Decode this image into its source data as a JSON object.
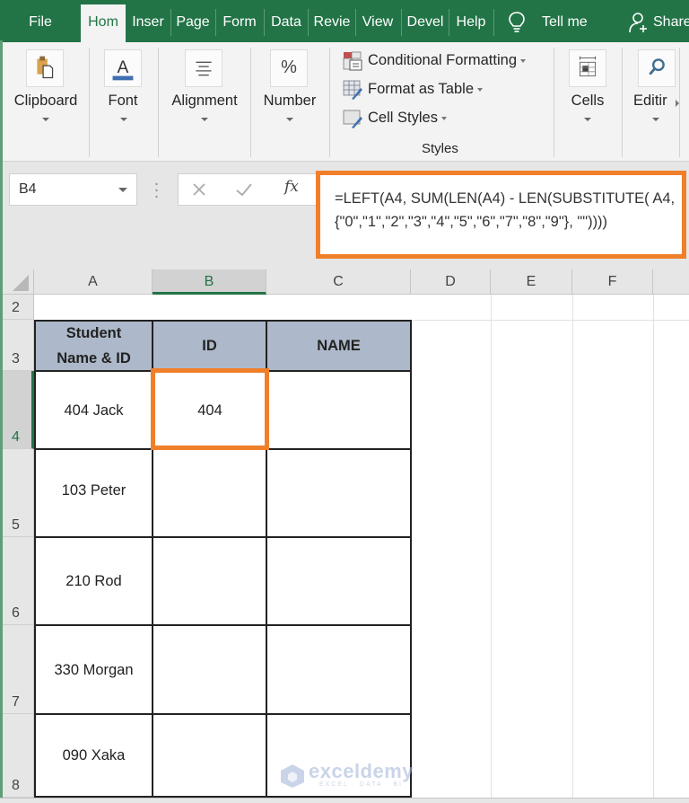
{
  "tabs": [
    {
      "label": "File",
      "active": false
    },
    {
      "label": "Hom",
      "active": true
    },
    {
      "label": "Inser",
      "active": false
    },
    {
      "label": "Page",
      "active": false
    },
    {
      "label": "Form",
      "active": false
    },
    {
      "label": "Data",
      "active": false
    },
    {
      "label": "Revie",
      "active": false
    },
    {
      "label": "View",
      "active": false
    },
    {
      "label": "Devel",
      "active": false
    },
    {
      "label": "Help",
      "active": false
    }
  ],
  "tell_me": "Tell me",
  "share": "Share",
  "ribbon": {
    "groups": {
      "clipboard": "Clipboard",
      "font": "Font",
      "alignment": "Alignment",
      "number": "Number",
      "cells": "Cells",
      "editing": "Editir",
      "styles": "Styles"
    },
    "styles_items": {
      "conditional_formatting": "Conditional Formatting",
      "format_as_table": "Format as Table",
      "cell_styles": "Cell Styles"
    },
    "number_icon": "%",
    "font_icon": "A"
  },
  "formula_bar": {
    "name_box": "B4",
    "fx": "fx",
    "formula": "=LEFT(A4, SUM(LEN(A4) - LEN(SUBSTITUTE( A4, {\"0\",\"1\",\"2\",\"3\",\"4\",\"5\",\"6\",\"7\",\"8\",\"9\"}, \"\"))))",
    "highlight_color": "#f07f2a"
  },
  "grid": {
    "columns": [
      "A",
      "B",
      "C",
      "D",
      "E",
      "F"
    ],
    "selected_column": "B",
    "rows": [
      "2",
      "3",
      "4",
      "5",
      "6",
      "7",
      "8"
    ],
    "selected_row": "4",
    "selected_cell": "B4"
  },
  "table": {
    "headers": [
      "Student\nName & ID",
      "ID",
      "NAME"
    ],
    "header_line1": "Student",
    "header_line2": "Name & ID",
    "header_fill": "#adb9ca",
    "rows": [
      {
        "name_id": "404 Jack",
        "id": "404",
        "name": ""
      },
      {
        "name_id": "103 Peter",
        "id": "",
        "name": ""
      },
      {
        "name_id": "210 Rod",
        "id": "",
        "name": ""
      },
      {
        "name_id": "330 Morgan",
        "id": "",
        "name": ""
      },
      {
        "name_id": "090 Xaka",
        "id": "",
        "name": ""
      }
    ]
  },
  "watermark": {
    "brand": "exceldemy",
    "tagline": "EXCEL · DATA · BI"
  },
  "colors": {
    "excel_green": "#227447",
    "accent_orange": "#f07f2a"
  }
}
